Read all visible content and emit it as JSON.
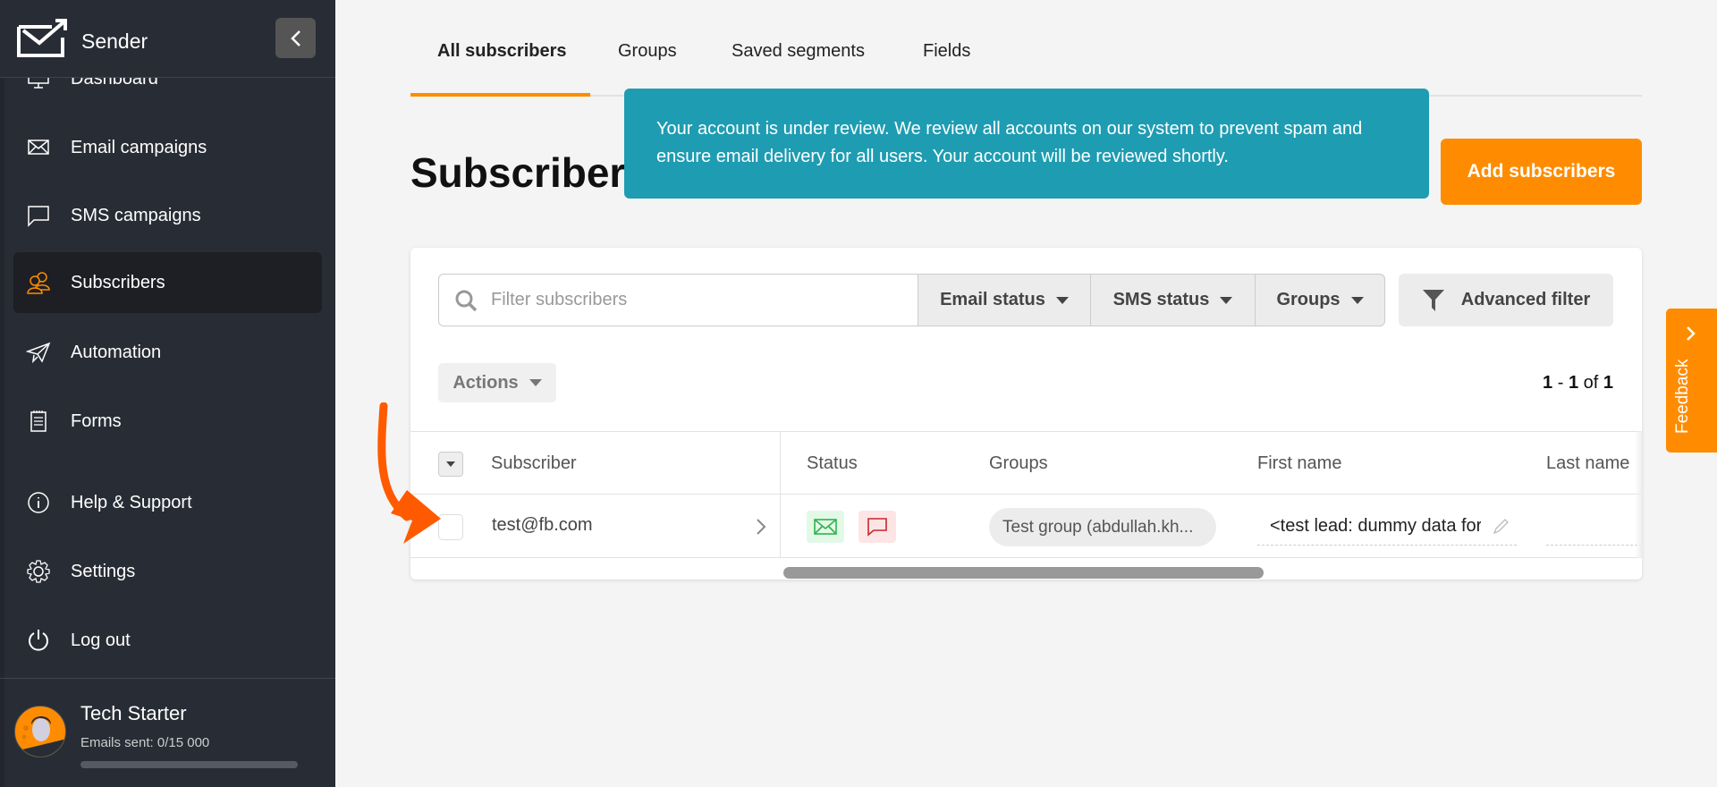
{
  "sidebar": {
    "brand": "Sender",
    "collapse_icon": "chevron-left-icon",
    "items": [
      {
        "label": "Dashboard",
        "icon": "monitor-icon",
        "active": false
      },
      {
        "label": "Email campaigns",
        "icon": "envelope-icon",
        "active": false
      },
      {
        "label": "SMS campaigns",
        "icon": "chat-bubble-icon",
        "active": false
      },
      {
        "label": "Subscribers",
        "icon": "users-icon",
        "active": true
      },
      {
        "label": "Automation",
        "icon": "paper-plane-icon",
        "active": false
      },
      {
        "label": "Forms",
        "icon": "notepad-icon",
        "active": false
      },
      {
        "label": "Help & Support",
        "icon": "info-icon",
        "active": false
      },
      {
        "label": "Settings",
        "icon": "gear-icon",
        "active": false
      },
      {
        "label": "Log out",
        "icon": "power-icon",
        "active": false
      }
    ],
    "profile": {
      "name": "Tech Starter",
      "emails_sent_label": "Emails sent: 0/15 000",
      "emails_sent": 0,
      "emails_limit": 15000
    }
  },
  "tabs": [
    {
      "label": "All subscribers",
      "active": true
    },
    {
      "label": "Groups",
      "active": false
    },
    {
      "label": "Saved segments",
      "active": false
    },
    {
      "label": "Fields",
      "active": false
    }
  ],
  "page_title": "Subscribers",
  "toast": {
    "message": "Your account is under review. We review all accounts on our system to prevent spam and ensure email delivery for all users. Your account will be reviewed shortly."
  },
  "add_button_label": "Add subscribers",
  "filters": {
    "search_placeholder": "Filter subscribers",
    "search_value": "",
    "dropdowns": [
      "Email status",
      "SMS status",
      "Groups"
    ],
    "advanced_label": "Advanced filter"
  },
  "actions_label": "Actions",
  "pagination": {
    "from": "1",
    "to": "1",
    "of_label": "of",
    "total": "1"
  },
  "table": {
    "columns": [
      "Subscriber",
      "Status",
      "Groups",
      "First name",
      "Last name"
    ],
    "rows": [
      {
        "email": "test@fb.com",
        "email_status": "active",
        "sms_status": "inactive",
        "group": "Test group (abdullah.kh...",
        "first_name": "<test lead: dummy data for first_name>",
        "last_name": ""
      }
    ]
  },
  "feedback_label": "Feedback",
  "colors": {
    "accent": "#ff8c00",
    "sidebar_bg": "#282c35",
    "toast_bg": "#1e9cb2",
    "email_status": "#2fb34a",
    "sms_status": "#c62828"
  }
}
